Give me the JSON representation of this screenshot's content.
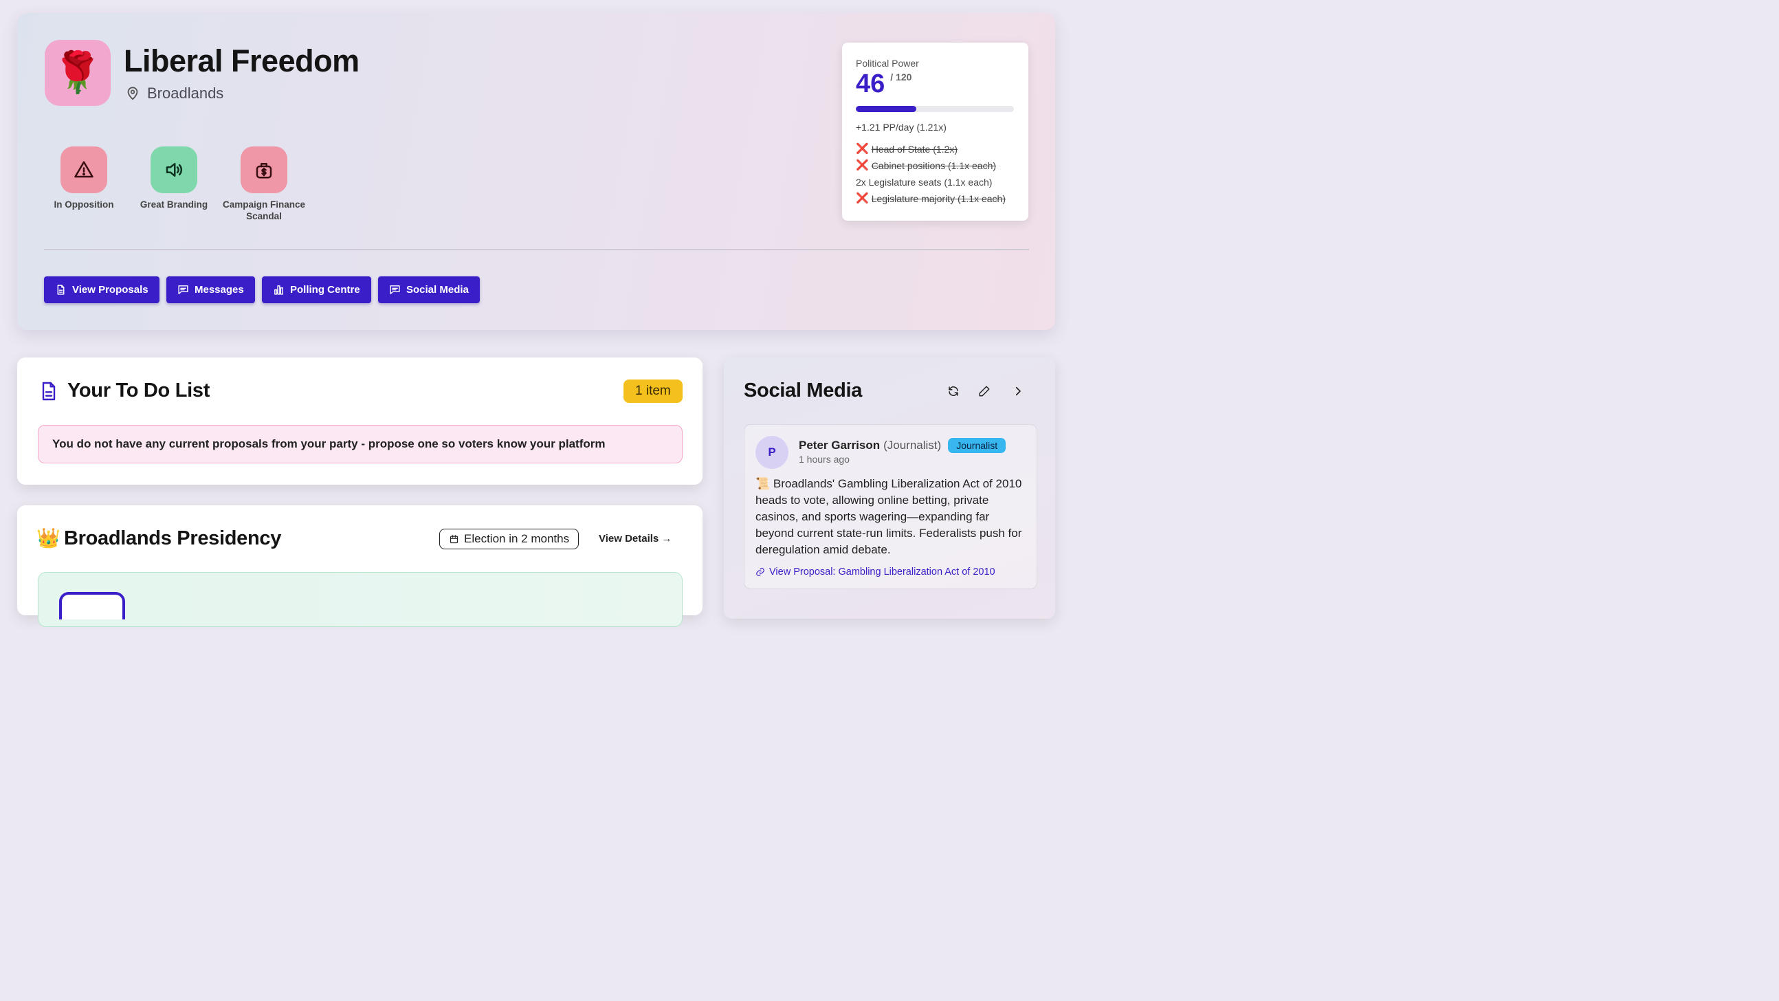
{
  "party": {
    "name": "Liberal Freedom",
    "emoji": "🌹",
    "location": "Broadlands",
    "logo_color": "#f2a7cf"
  },
  "traits": [
    {
      "label": "In Opposition",
      "icon": "warning-icon",
      "color": "#ef97a6"
    },
    {
      "label": "Great Branding",
      "icon": "speaker-icon",
      "color": "#7fd8ab"
    },
    {
      "label": "Campaign Finance Scandal",
      "icon": "money-bag-icon",
      "color": "#ef97a6"
    }
  ],
  "nav_buttons": [
    {
      "label": "View Proposals",
      "icon": "document-icon"
    },
    {
      "label": "Messages",
      "icon": "message-icon"
    },
    {
      "label": "Polling Centre",
      "icon": "bar-chart-icon"
    },
    {
      "label": "Social Media",
      "icon": "message-icon"
    }
  ],
  "political_power": {
    "title": "Political Power",
    "value": "46",
    "max": "/ 120",
    "fraction": 0.383,
    "rate": "+1.21 PP/day (1.21x)",
    "modifiers": [
      {
        "text": "Head of State (1.2x)",
        "active": false
      },
      {
        "text": "Cabinet positions (1.1x each)",
        "active": false
      },
      {
        "text": "2x Legislature seats (1.1x each)",
        "active": true
      },
      {
        "text": "Legislature majority (1.1x each)",
        "active": false
      }
    ],
    "inactive_marker": "❌"
  },
  "todo": {
    "title": "Your To Do List",
    "badge": "1 item",
    "items": [
      "You do not have any current proposals from your party - propose one so voters know your platform"
    ]
  },
  "presidency": {
    "emoji": "👑",
    "title": "Broadlands Presidency",
    "election": "Election in 2 months",
    "view_details": "View Details →"
  },
  "social": {
    "title": "Social Media",
    "post": {
      "initial": "P",
      "author": "Peter Garrison",
      "role": "(Journalist)",
      "badge": "Journalist",
      "time": "1 hours ago",
      "body": "📜 Broadlands' Gambling Liberalization Act of 2010 heads to vote, allowing online betting, private casinos, and sports wagering—expanding far beyond current state-run limits. Federalists push for deregulation amid debate.",
      "link": "View Proposal: Gambling Liberalization Act of 2010"
    }
  },
  "colors": {
    "accent": "#3a1ec7",
    "badge_yellow": "#f4c01e",
    "journalist_badge": "#38b6f0"
  }
}
